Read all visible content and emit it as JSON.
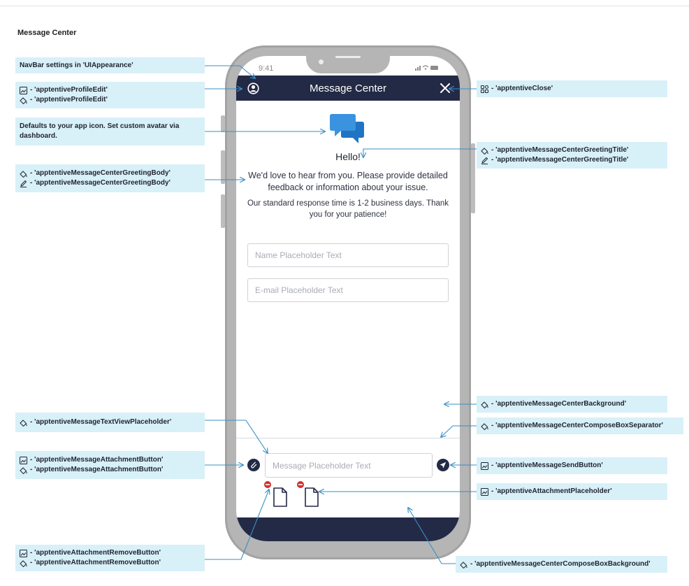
{
  "page": {
    "title": "Message Center"
  },
  "phone": {
    "status_time": "9:41",
    "nav_title": "Message Center",
    "greeting_title": "Hello!",
    "greeting_body": "We'd love to hear from you. Please provide detailed feedback or information about your issue.",
    "response_note": "Our standard response time is 1-2 business days. Thank you for your patience!",
    "name_placeholder": "Name Placeholder Text",
    "email_placeholder": "E-mail Placeholder Text",
    "message_placeholder": "Message Placeholder Text"
  },
  "annotations": {
    "navbar": "NavBar settings in 'UIAppearance'",
    "profile_image": "- 'apptentiveProfileEdit'",
    "profile_tint": "- 'apptentiveProfileEdit'",
    "avatar_line1": "Defaults to your app icon. Set custom avatar via",
    "avatar_line2": "dashboard.",
    "body_color": "- 'apptentiveMessageCenterGreetingBody'",
    "body_font": "- 'apptentiveMessageCenterGreetingBody'",
    "close": "- 'apptentiveClose'",
    "title_color": "- 'apptentiveMessageCenterGreetingTitle'",
    "title_font": "- 'apptentiveMessageCenterGreetingTitle'",
    "background": "- 'apptentiveMessageCenterBackground'",
    "separator": "- 'apptentiveMessageCenterComposeBoxSeparator'",
    "text_placeholder": "- 'apptentiveMessageTextViewPlaceholder'",
    "attach_image": "- 'apptentiveMessageAttachmentButton'",
    "attach_tint": "- 'apptentiveMessageAttachmentButton'",
    "send": "- 'apptentiveMessageSendButton'",
    "attachment_placeholder": "- 'apptentiveAttachmentPlaceholder'",
    "remove_image": "- 'apptentiveAttachmentRemoveButton'",
    "remove_tint": "- 'apptentiveAttachmentRemoveButton'",
    "compose_bg": "- 'apptentiveMessageCenterComposeBoxBackground'"
  },
  "icons": {
    "image_asset": "image-icon",
    "color": "paint-bucket-icon",
    "font": "pencil-icon",
    "multi_asset": "grid-icon"
  },
  "colors": {
    "navbar": "#232a46",
    "callout": "#d8f0f8",
    "arrow": "#3a8fc4",
    "remove": "#d0312d"
  }
}
